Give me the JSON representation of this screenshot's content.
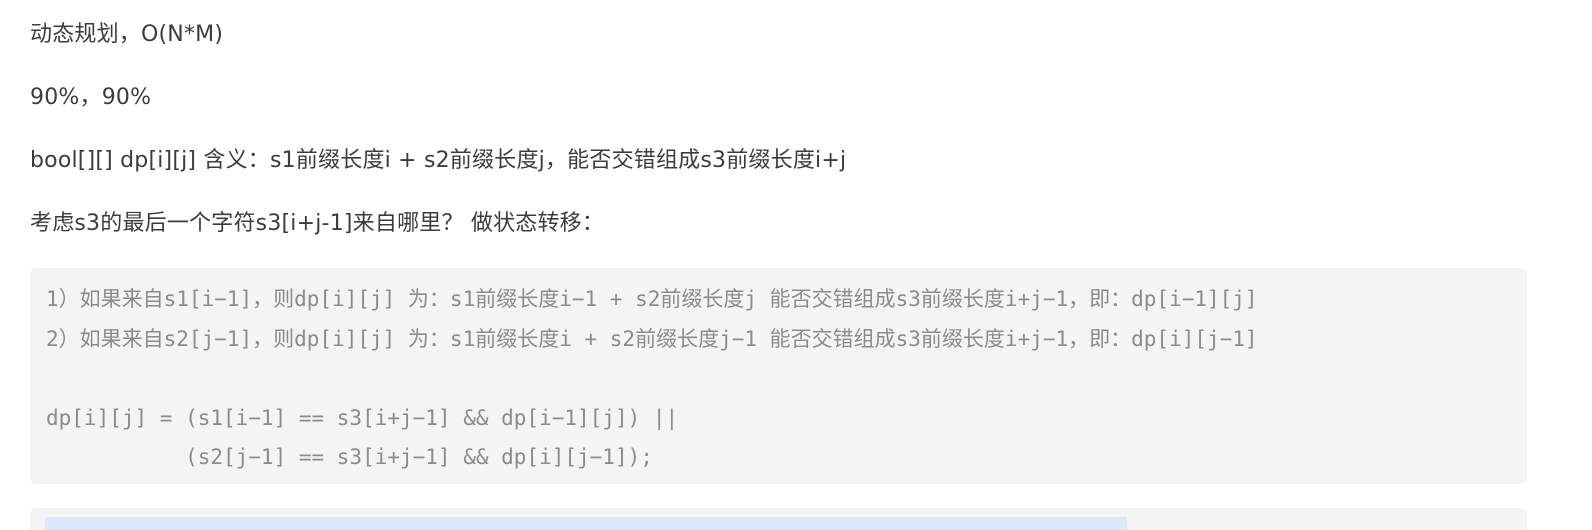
{
  "paragraphs": {
    "complexity": "动态规划，O(N*M)",
    "performance": "90%，90%",
    "definition": "bool[][] dp[i][j] 含义：s1前缀长度i + s2前缀长度j，能否交错组成s3前缀长度i+j",
    "transition_intro": "考虑s3的最后一个字符s3[i+j-1]来自哪里？ 做状态转移："
  },
  "code": {
    "lines": [
      "1）如果来自s1[i−1]，则dp[i][j] 为：s1前缀长度i−1 + s2前缀长度j 能否交错组成s3前缀长度i+j−1，即：dp[i−1][j]",
      "2）如果来自s2[j−1]，则dp[i][j] 为：s1前缀长度i + s2前缀长度j−1 能否交错组成s3前缀长度i+j−1，即：dp[i][j−1]",
      "",
      "dp[i][j] = (s1[i−1] == s3[i+j−1] && dp[i−1][j]) ||",
      "           (s2[j−1] == s3[i+j−1] && dp[i][j−1]);"
    ]
  },
  "colors": {
    "text": "#3c3c3c",
    "code_text": "#8b8b8b",
    "code_background": "#f4f4f4",
    "selection": "#dbe9fa"
  }
}
